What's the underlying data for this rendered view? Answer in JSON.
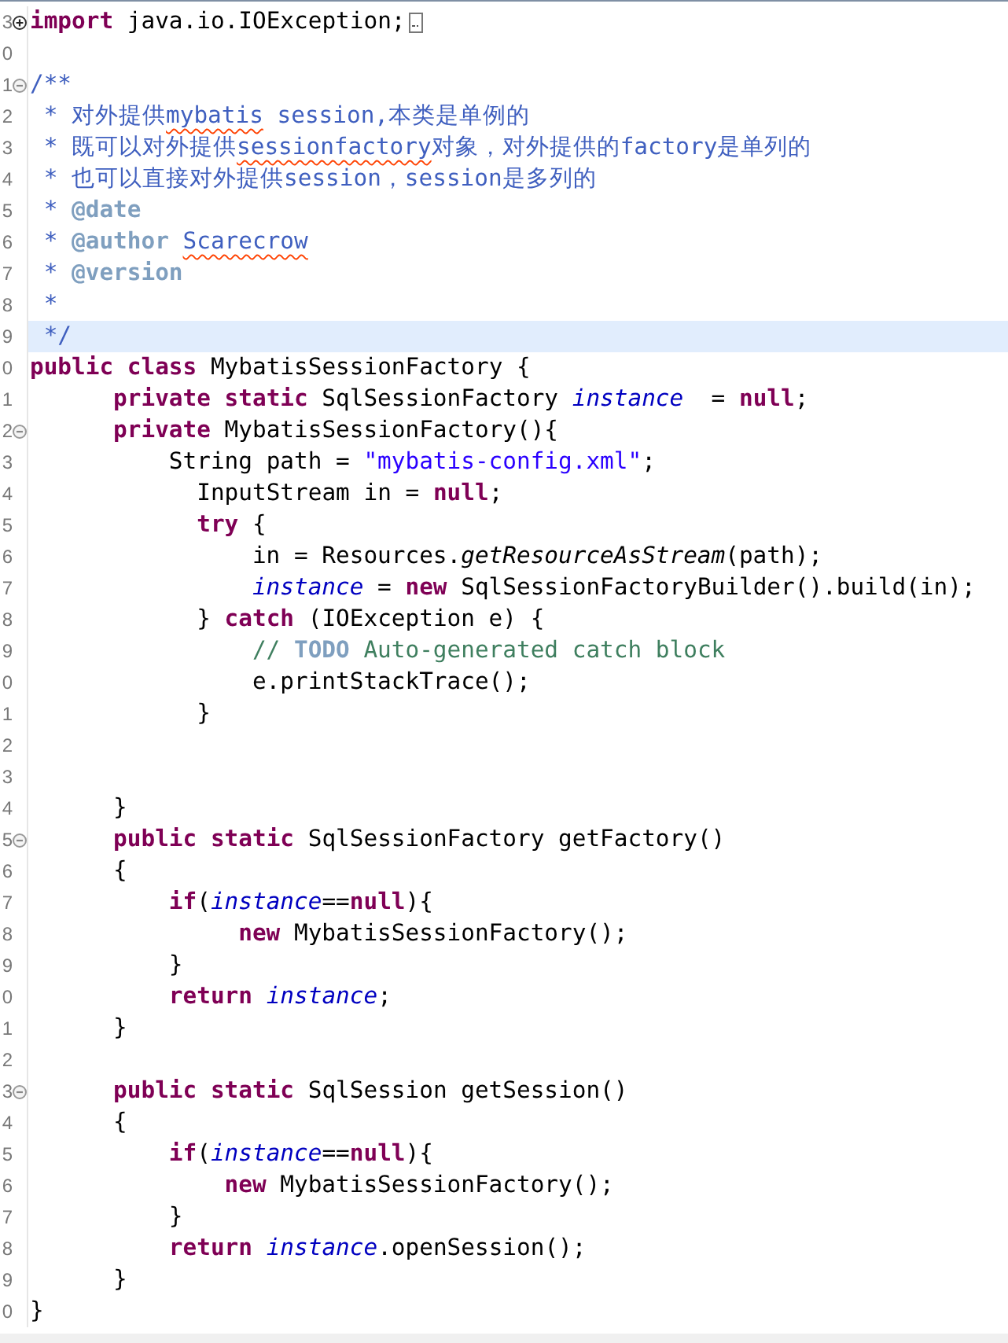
{
  "editor": {
    "lines": [
      {
        "number": "3",
        "expanded": false,
        "current": false,
        "tokens": [
          {
            "kind": "keyword",
            "text": "import"
          },
          {
            "kind": "plain",
            "text": " java.io.IOException;"
          }
        ]
      },
      {
        "number": "0",
        "current": false
      },
      {
        "number": "1",
        "expanded": true,
        "current": false,
        "tokens": [
          {
            "kind": "javadoc",
            "text": "/**"
          }
        ]
      },
      {
        "number": "2",
        "current": false,
        "tokens": [
          {
            "kind": "javadoc",
            "text": " * 对外提供"
          },
          {
            "kind": "javadoc",
            "text": "mybatis",
            "misspelled": true
          },
          {
            "kind": "javadoc",
            "text": " session,本类是单例的"
          }
        ]
      },
      {
        "number": "3",
        "current": false,
        "tokens": [
          {
            "kind": "javadoc",
            "text": " * 既可以对外提供"
          },
          {
            "kind": "javadoc",
            "text": "sessionfactory",
            "misspelled": true
          },
          {
            "kind": "javadoc",
            "text": "对象，对外提供的factory是单列的"
          }
        ]
      },
      {
        "number": "4",
        "current": false,
        "tokens": [
          {
            "kind": "javadoc",
            "text": " * 也可以直接对外提供session，session是多列的"
          }
        ]
      },
      {
        "number": "5",
        "current": false,
        "tokens": [
          {
            "kind": "javadoc",
            "text": " * "
          },
          {
            "kind": "javadoc-tag",
            "text": "@date"
          }
        ]
      },
      {
        "number": "6",
        "current": false,
        "tokens": [
          {
            "kind": "javadoc",
            "text": " * "
          },
          {
            "kind": "javadoc-tag",
            "text": "@author "
          },
          {
            "kind": "javadoc",
            "text": "Scarecrow",
            "misspelled": true
          }
        ]
      },
      {
        "number": "7",
        "current": false,
        "tokens": [
          {
            "kind": "javadoc",
            "text": " * "
          },
          {
            "kind": "javadoc-tag",
            "text": "@version"
          }
        ]
      },
      {
        "number": "8",
        "current": false,
        "tokens": [
          {
            "kind": "javadoc",
            "text": " *"
          }
        ]
      },
      {
        "number": "9",
        "current": true,
        "tokens": [
          {
            "kind": "javadoc",
            "text": " */"
          }
        ]
      },
      {
        "number": "0",
        "current": false,
        "tokens": [
          {
            "kind": "keyword",
            "text": "public class"
          },
          {
            "kind": "plain",
            "text": " MybatisSessionFactory {"
          }
        ]
      },
      {
        "number": "1",
        "current": false,
        "tokens": [
          {
            "kind": "keyword",
            "text": "      private static"
          },
          {
            "kind": "plain",
            "text": " SqlSessionFactory "
          },
          {
            "kind": "field",
            "text": "instance"
          },
          {
            "kind": "plain",
            "text": "  = "
          },
          {
            "kind": "keyword",
            "text": "null"
          },
          {
            "kind": "plain",
            "text": ";"
          }
        ]
      },
      {
        "number": "2",
        "expanded": true,
        "current": false,
        "tokens": [
          {
            "kind": "keyword",
            "text": "      private"
          },
          {
            "kind": "plain",
            "text": " MybatisSessionFactory(){"
          }
        ]
      },
      {
        "number": "3",
        "current": false,
        "tokens": [
          {
            "kind": "plain",
            "text": "          String path = "
          },
          {
            "kind": "string",
            "text": "\"mybatis-config.xml\""
          },
          {
            "kind": "plain",
            "text": ";"
          }
        ]
      },
      {
        "number": "4",
        "current": false,
        "tokens": [
          {
            "kind": "plain",
            "text": "            InputStream in = "
          },
          {
            "kind": "keyword",
            "text": "null"
          },
          {
            "kind": "plain",
            "text": ";"
          }
        ]
      },
      {
        "number": "5",
        "current": false,
        "tokens": [
          {
            "kind": "keyword",
            "text": "            try"
          },
          {
            "kind": "plain",
            "text": " {"
          }
        ]
      },
      {
        "number": "6",
        "current": false,
        "tokens": [
          {
            "kind": "plain",
            "text": "                in = Resources."
          },
          {
            "kind": "static-call",
            "text": "getResourceAsStream"
          },
          {
            "kind": "plain",
            "text": "(path);"
          }
        ]
      },
      {
        "number": "7",
        "current": false,
        "tokens": [
          {
            "kind": "field",
            "text": "                instance"
          },
          {
            "kind": "plain",
            "text": " = "
          },
          {
            "kind": "keyword",
            "text": "new"
          },
          {
            "kind": "plain",
            "text": " SqlSessionFactoryBuilder().build(in);"
          }
        ]
      },
      {
        "number": "8",
        "current": false,
        "tokens": [
          {
            "kind": "plain",
            "text": "            } "
          },
          {
            "kind": "keyword",
            "text": "catch"
          },
          {
            "kind": "plain",
            "text": " (IOException e) {"
          }
        ]
      },
      {
        "number": "9",
        "current": false,
        "tokens": [
          {
            "kind": "comment",
            "text": "                // "
          },
          {
            "kind": "todo",
            "text": "TODO"
          },
          {
            "kind": "comment",
            "text": " Auto-generated catch block"
          }
        ]
      },
      {
        "number": "0",
        "current": false,
        "tokens": [
          {
            "kind": "plain",
            "text": "                e.printStackTrace();"
          }
        ]
      },
      {
        "number": "1",
        "current": false,
        "tokens": [
          {
            "kind": "plain",
            "text": "            }"
          }
        ]
      },
      {
        "number": "2",
        "current": false
      },
      {
        "number": "3",
        "current": false
      },
      {
        "number": "4",
        "current": false,
        "tokens": [
          {
            "kind": "plain",
            "text": "      }"
          }
        ]
      },
      {
        "number": "5",
        "expanded": true,
        "current": false,
        "tokens": [
          {
            "kind": "keyword",
            "text": "      public static"
          },
          {
            "kind": "plain",
            "text": " SqlSessionFactory getFactory()"
          }
        ]
      },
      {
        "number": "6",
        "current": false,
        "tokens": [
          {
            "kind": "plain",
            "text": "      {"
          }
        ]
      },
      {
        "number": "7",
        "current": false,
        "tokens": [
          {
            "kind": "keyword",
            "text": "          if"
          },
          {
            "kind": "plain",
            "text": "("
          },
          {
            "kind": "field",
            "text": "instance"
          },
          {
            "kind": "plain",
            "text": "=="
          },
          {
            "kind": "keyword",
            "text": "null"
          },
          {
            "kind": "plain",
            "text": "){"
          }
        ]
      },
      {
        "number": "8",
        "current": false,
        "tokens": [
          {
            "kind": "keyword",
            "text": "               new"
          },
          {
            "kind": "plain",
            "text": " MybatisSessionFactory();"
          }
        ]
      },
      {
        "number": "9",
        "current": false,
        "tokens": [
          {
            "kind": "plain",
            "text": "          }"
          }
        ]
      },
      {
        "number": "0",
        "current": false,
        "tokens": [
          {
            "kind": "keyword",
            "text": "          return"
          },
          {
            "kind": "field",
            "text": " instance"
          },
          {
            "kind": "plain",
            "text": ";"
          }
        ]
      },
      {
        "number": "1",
        "current": false,
        "tokens": [
          {
            "kind": "plain",
            "text": "      }"
          }
        ]
      },
      {
        "number": "2",
        "current": false
      },
      {
        "number": "3",
        "expanded": true,
        "current": false,
        "tokens": [
          {
            "kind": "keyword",
            "text": "      public static"
          },
          {
            "kind": "plain",
            "text": " SqlSession getSession()"
          }
        ]
      },
      {
        "number": "4",
        "current": false,
        "tokens": [
          {
            "kind": "plain",
            "text": "      {"
          }
        ]
      },
      {
        "number": "5",
        "current": false,
        "tokens": [
          {
            "kind": "keyword",
            "text": "          if"
          },
          {
            "kind": "plain",
            "text": "("
          },
          {
            "kind": "field",
            "text": "instance"
          },
          {
            "kind": "plain",
            "text": "=="
          },
          {
            "kind": "keyword",
            "text": "null"
          },
          {
            "kind": "plain",
            "text": "){"
          }
        ]
      },
      {
        "number": "6",
        "current": false,
        "tokens": [
          {
            "kind": "keyword",
            "text": "              new"
          },
          {
            "kind": "plain",
            "text": " MybatisSessionFactory();"
          }
        ]
      },
      {
        "number": "7",
        "current": false,
        "tokens": [
          {
            "kind": "plain",
            "text": "          }"
          }
        ]
      },
      {
        "number": "8",
        "current": false,
        "tokens": [
          {
            "kind": "keyword",
            "text": "          return"
          },
          {
            "kind": "field",
            "text": " instance"
          },
          {
            "kind": "plain",
            "text": ".openSession();"
          }
        ]
      },
      {
        "number": "9",
        "current": false,
        "tokens": [
          {
            "kind": "plain",
            "text": "      }"
          }
        ]
      },
      {
        "number": "0",
        "current": false,
        "tokens": [
          {
            "kind": "plain",
            "text": "}"
          }
        ]
      }
    ]
  }
}
